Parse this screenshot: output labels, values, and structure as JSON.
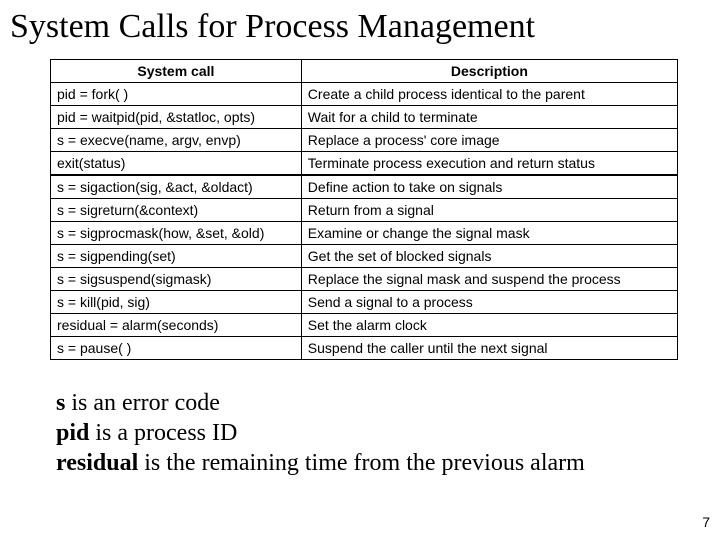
{
  "title": "System Calls for Process Management",
  "table": {
    "headers": {
      "call": "System call",
      "desc": "Description"
    },
    "rows": [
      {
        "call": "pid = fork( )",
        "desc": "Create a child process identical to the parent"
      },
      {
        "call": "pid = waitpid(pid, &statloc, opts)",
        "desc": "Wait for a child to terminate"
      },
      {
        "call": "s = execve(name, argv, envp)",
        "desc": "Replace a process' core image"
      },
      {
        "call": "exit(status)",
        "desc": "Terminate process execution and return status"
      },
      {
        "call": "s = sigaction(sig, &act, &oldact)",
        "desc": "Define action to take on signals"
      },
      {
        "call": "s = sigreturn(&context)",
        "desc": "Return from a signal"
      },
      {
        "call": "s = sigprocmask(how, &set, &old)",
        "desc": "Examine or change the signal mask"
      },
      {
        "call": "s = sigpending(set)",
        "desc": "Get the set of blocked signals"
      },
      {
        "call": "s = sigsuspend(sigmask)",
        "desc": "Replace the signal mask and suspend the process"
      },
      {
        "call": "s = kill(pid, sig)",
        "desc": "Send a signal to a process"
      },
      {
        "call": "residual = alarm(seconds)",
        "desc": "Set the alarm clock"
      },
      {
        "call": "s = pause( )",
        "desc": "Suspend the caller until the next signal"
      }
    ]
  },
  "notes": {
    "l1b": "s",
    "l1": " is an error code",
    "l2b": "pid",
    "l2": " is a process ID",
    "l3b": "residual",
    "l3": " is the remaining time from the previous alarm"
  },
  "pagenum": "7"
}
